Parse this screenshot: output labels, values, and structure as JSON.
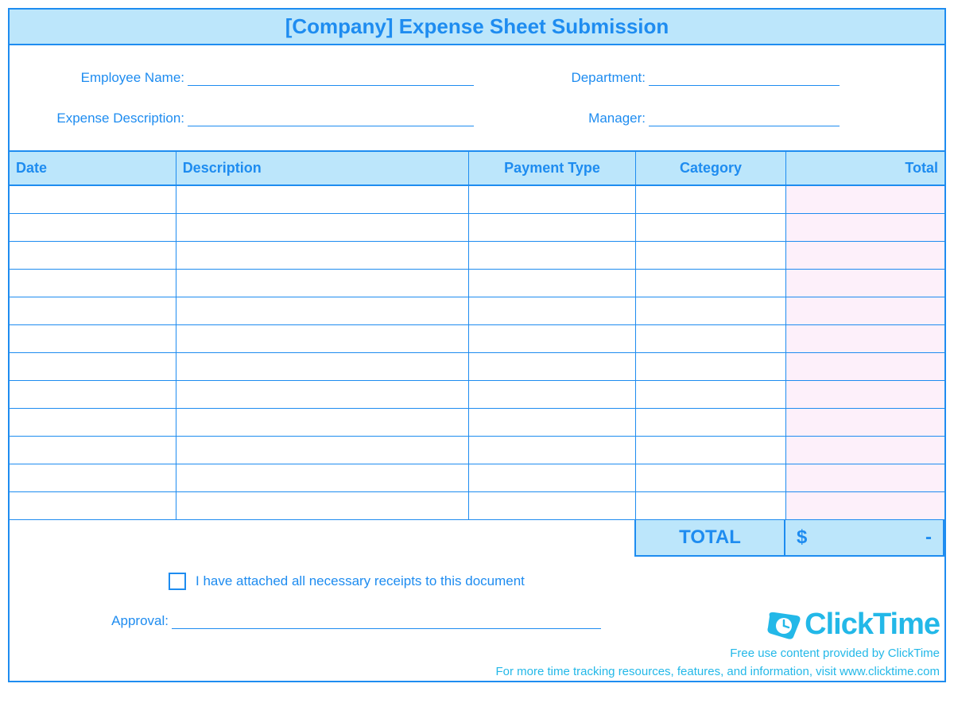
{
  "title": "[Company] Expense Sheet Submission",
  "fields": {
    "employee_name_label": "Employee Name:",
    "department_label": "Department:",
    "expense_desc_label": "Expense Description:",
    "manager_label": "Manager:",
    "approval_label": "Approval:"
  },
  "table": {
    "headers": {
      "date": "Date",
      "description": "Description",
      "payment_type": "Payment Type",
      "category": "Category",
      "total": "Total"
    },
    "row_count": 12,
    "total_label": "TOTAL",
    "total_currency": "$",
    "total_value": "-"
  },
  "receipts_checkbox_label": "I have attached all necessary receipts to this document",
  "logo_text": "ClickTime",
  "footer_line1": "Free use content provided by ClickTime",
  "footer_line2": "For more time tracking resources, features, and information, visit www.clicktime.com"
}
